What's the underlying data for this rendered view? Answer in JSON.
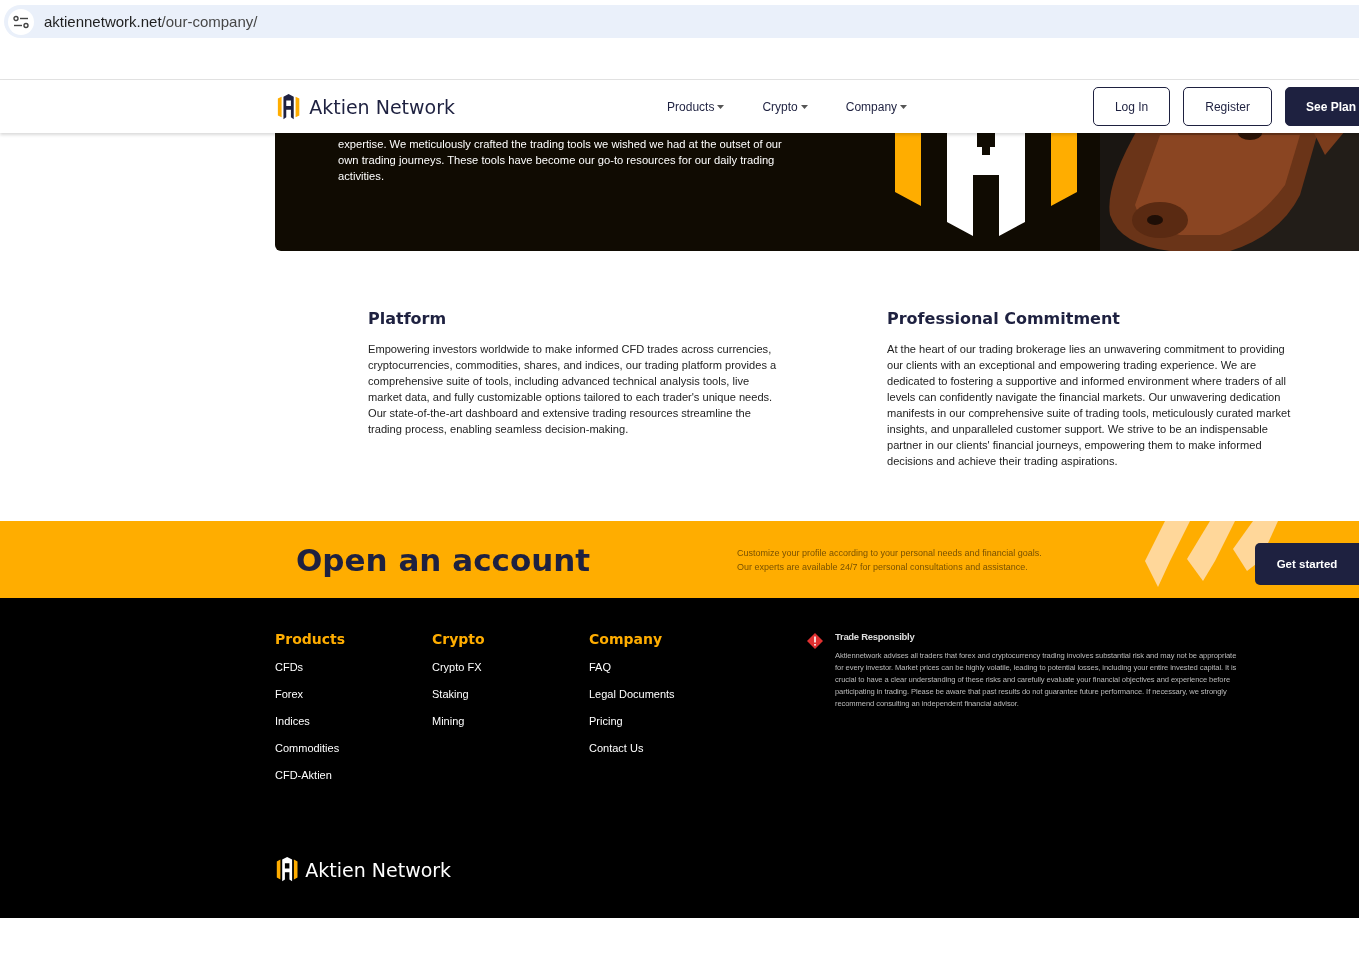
{
  "browser": {
    "url_host": "aktiennetwork.net",
    "url_path": "/our-company/"
  },
  "header": {
    "brand": "Aktien Network",
    "nav": [
      {
        "label": "Products"
      },
      {
        "label": "Crypto"
      },
      {
        "label": "Company"
      }
    ],
    "buttons": [
      {
        "label": "Log In",
        "kind": "outline"
      },
      {
        "label": "Register",
        "kind": "outline"
      },
      {
        "label": "See Plan",
        "kind": "solid"
      }
    ]
  },
  "hero": {
    "text": "expertise. We meticulously crafted the trading tools we wished we had at the outset of our own trading journeys. These tools have become our go-to resources for our daily trading activities."
  },
  "features": [
    {
      "title": "Platform",
      "text": "Empowering investors worldwide to make informed CFD trades across currencies, cryptocurrencies, commodities, shares, and indices, our trading platform provides a comprehensive suite of tools, including advanced technical analysis tools, live market data, and fully customizable options tailored to each trader's unique needs. Our state-of-the-art dashboard and extensive trading resources streamline the trading process, enabling seamless decision-making."
    },
    {
      "title": "Professional Commitment",
      "text": "At the heart of our trading brokerage lies an unwavering commitment to providing our clients with an exceptional and empowering trading experience. We are dedicated to fostering a supportive and informed environment where traders of all levels can confidently navigate the financial markets. Our unwavering dedication manifests in our comprehensive suite of trading tools, meticulously curated market insights, and unparalleled customer support. We strive to be an indispensable partner in our clients' financial journeys, empowering them to make informed decisions and achieve their trading aspirations."
    }
  ],
  "cta": {
    "title": "Open an account",
    "text_lines": [
      "Customize your profile according to your personal needs and financial goals.",
      "Our experts are available 24/7 for personal consultations and assistance."
    ],
    "button": "Get started"
  },
  "footer": {
    "columns": [
      {
        "heading": "Products",
        "links": [
          "CFDs",
          "Forex",
          "Indices",
          "Commodities",
          "CFD-Aktien"
        ]
      },
      {
        "heading": "Crypto",
        "links": [
          "Crypto FX",
          "Staking",
          "Mining"
        ]
      },
      {
        "heading": "Company",
        "links": [
          "FAQ",
          "Legal Documents",
          "Pricing",
          "Contact Us"
        ]
      }
    ],
    "notice": {
      "title": "Trade Responsibly",
      "text": "Aktiennetwork advises all traders that forex and cryptocurrency trading involves substantial risk and may not be appropriate for every investor. Market prices can be highly volatile, leading to potential losses, including your entire invested capital. It is crucial to have a clear understanding of these risks and carefully evaluate your financial objectives and experience before participating in trading. Please be aware that past results do not guarantee future performance. If necessary, we strongly recommend consulting an independent financial advisor."
    },
    "brand": "Aktien Network"
  }
}
